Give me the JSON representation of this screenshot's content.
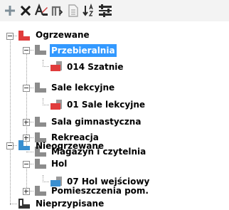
{
  "toolbar": {
    "buttons": [
      {
        "name": "add-button",
        "icon": "plus-icon",
        "color": "#7f8f99"
      },
      {
        "name": "delete-button",
        "icon": "cross-icon",
        "color": "#1e1e1e"
      },
      {
        "name": "rename-button",
        "icon": "rename-icon",
        "color": "#2a2a2a"
      },
      {
        "name": "move-up-button",
        "icon": "move-up-icon",
        "color": "#6e6e6e"
      },
      {
        "name": "document-button",
        "icon": "document-icon",
        "color": "#a8a8a8"
      },
      {
        "name": "sort-button",
        "icon": "sort-icon",
        "color": "#2a2a2a"
      },
      {
        "name": "filter-button",
        "icon": "filter-icon",
        "color": "#2a2a2a"
      }
    ]
  },
  "tree": {
    "nodes": [
      {
        "label": "Ogrzewane",
        "bold": true,
        "selected": false,
        "icon": "zone-heated-icon",
        "accent": "#e03c3c",
        "expander": "minus"
      },
      {
        "label": "Przebieralnia",
        "bold": true,
        "selected": true,
        "icon": "group-heated-icon",
        "accent": "#e03c3c",
        "expander": "minus"
      },
      {
        "label": "014 Szatnie",
        "bold": true,
        "selected": false,
        "icon": "room-heated-icon",
        "accent": "#e03c3c",
        "expander": null
      },
      {
        "label": "Sale lekcyjne",
        "bold": true,
        "selected": false,
        "icon": "group-heated-icon",
        "accent": "#e03c3c",
        "expander": "minus"
      },
      {
        "label": "01 Sale lekcyjne",
        "bold": true,
        "selected": false,
        "icon": "room-heated-icon",
        "accent": "#e03c3c",
        "expander": null
      },
      {
        "label": "Sala gimnastyczna",
        "bold": true,
        "selected": false,
        "icon": "group-heated-icon",
        "accent": "#e03c3c",
        "expander": "plus"
      },
      {
        "label": "Rekreacja",
        "bold": true,
        "selected": false,
        "icon": "group-heated-icon",
        "accent": "#e03c3c",
        "expander": "plus"
      },
      {
        "label": "Magazyn i czytelnia",
        "bold": true,
        "selected": false,
        "icon": "group-heated-icon",
        "accent": "#e03c3c",
        "expander": null
      },
      {
        "label": "Nieogrzewane",
        "bold": true,
        "selected": false,
        "icon": "zone-unheated-icon",
        "accent": "#3a8fd0",
        "expander": "minus"
      },
      {
        "label": "Hol",
        "bold": true,
        "selected": false,
        "icon": "group-unheated-icon",
        "accent": "#3a8fd0",
        "expander": "minus"
      },
      {
        "label": "07 Hol wejściowy",
        "bold": true,
        "selected": false,
        "icon": "room-unheated-icon",
        "accent": "#3a8fd0",
        "expander": null
      },
      {
        "label": "Pomieszczenia pom.",
        "bold": true,
        "selected": false,
        "icon": "group-unheated-icon",
        "accent": "#3a8fd0",
        "expander": "plus"
      },
      {
        "label": "Nieprzypisane",
        "bold": true,
        "selected": false,
        "icon": "zone-unassigned-icon",
        "accent": "#333333",
        "expander": null
      }
    ]
  }
}
